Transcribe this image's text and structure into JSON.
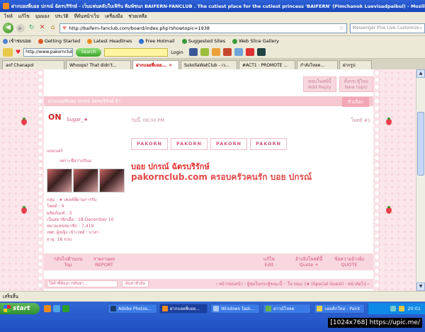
{
  "window": {
    "title": "ฝากบอยพี่บอย ปกรณ์ ฉัตรบริรักษ์ - เว็บแฟนคลับใบเฟิร์น พิมพ์ชนก BAIFERN-FANCLUB . The cutiest place for the cutiest princess 'BAIFERN' (Pimchanok Luevisadpaibul) - Mozilla Firefox"
  },
  "menubar": [
    "ไฟล์",
    "แก้ไข",
    "มุมมอง",
    "ประวัติ",
    "ที่คั่นหน้าเว็บ",
    "เครื่องมือ",
    "ช่วยเหลือ"
  ],
  "nav": {
    "url": "http://baifern-fanclub.com/board/index.php?showtopic=1938",
    "search_placeholder": "Messenger Plus Live Customize"
  },
  "bookmarks": [
    "เข้าชมบ่อย",
    "Getting Started",
    "Latest Headlines",
    "Free Hotmail",
    "Suggested Sites",
    "Web Slice Gallery"
  ],
  "toolbar2": {
    "url": "http://www.pakornclub.cc",
    "search_button": "Search",
    "login": "Login"
  },
  "tabs": [
    {
      "label": "aof Chanapol",
      "active": false
    },
    {
      "label": "Whoops! That didn't...",
      "active": false
    },
    {
      "label": "ฝากบอยพี่บอย...",
      "active": true
    },
    {
      "label": "SukollaWatClub - เว...",
      "active": false
    },
    {
      "label": "#ACT1 : PROMOTE ...",
      "active": false
    },
    {
      "label": "กำลังโหลด...",
      "active": false
    },
    {
      "label": "ฝากรูป",
      "active": false
    }
  ],
  "forum": {
    "top_buttons": [
      {
        "th": "ตอบโพสต์นี้",
        "en": "Add Reply"
      },
      {
        "th": "ตั้งกระทู้ใหม่",
        "en": "New topic"
      }
    ],
    "header_text": "ฝากบอยพี่บอย ปกรณ์ ฉัตรบริรักษ์ จ้า",
    "options_button": "ตัวเลือก",
    "username": "Sugar_★",
    "post_date": "วันนี้, 08:00 PM",
    "reply_no": "โพสต์ #1",
    "rank": "เมมเบอร์",
    "photo_caption": "เพราะชื่อว่าปรันย",
    "stats": [
      "กลุ่ม : ★ เคลท์ที่ผ่านการรับ",
      "โพสต์ : 4",
      "ผลิตภัณฑ์ : 3",
      "เป็นสมาชิกเมื่อ : 18-December 10",
      "หมายเลขสมาชิก : 7,419",
      "เพศ: ผู้หญิง เข้าเวทย์ : บาลา",
      "อายุ: 18 ขวบ"
    ],
    "stamps": [
      "PAKORN",
      "PAKORN",
      "PAKORN",
      "PAKORN"
    ],
    "post_line1": "บอย ปกรณ์ ฉัตรบริรักษ์",
    "post_line2": "pakornclub.com ครอบครัวคนรัก บอย ปกรณ์",
    "actions": [
      {
        "th": "กลับไปด้านบน",
        "en": "Top"
      },
      {
        "th": "รายงานผล",
        "en": "REPORT"
      },
      {
        "th": "แก้ไข",
        "en": "Edit"
      },
      {
        "th": "อ้างอิงโพสต์นี้",
        "en": "Quote +"
      },
      {
        "th": "ข้อความอ้างอิง",
        "en": "QUOTE"
      }
    ],
    "search_placeholder": "ใส่คำที่ต้องการค้นหา...",
    "search_button": "ค้นหาหัวข้อ",
    "pager": "‹ หน้าก่อนหน้า · ผู้ชมในกระทู้ขณะนี้ ·· ใน ขณะ (★ (Special Guest) · หน้าถัดไป ›"
  },
  "statusbar": "เสร็จสิ้น",
  "taskbar": {
    "start": "start",
    "items": [
      {
        "label": "Adobe Photos...",
        "active": false
      },
      {
        "label": "ฝากบอยพี่บอย...",
        "active": true
      },
      {
        "label": "Windows Task...",
        "active": false
      },
      {
        "label": "ดาวน์โหลด",
        "active": false
      },
      {
        "label": "บอยคิกใหม่ - Paint",
        "active": false
      }
    ],
    "clock": "20:01",
    "resolution_badge": "[1024x768] https://upic.me/"
  },
  "colors": {
    "page_bg": "#fbe6ea",
    "accent_pink": "#d3577a",
    "post_red": "#e23131",
    "xp_blue": "#1f4fc2"
  }
}
